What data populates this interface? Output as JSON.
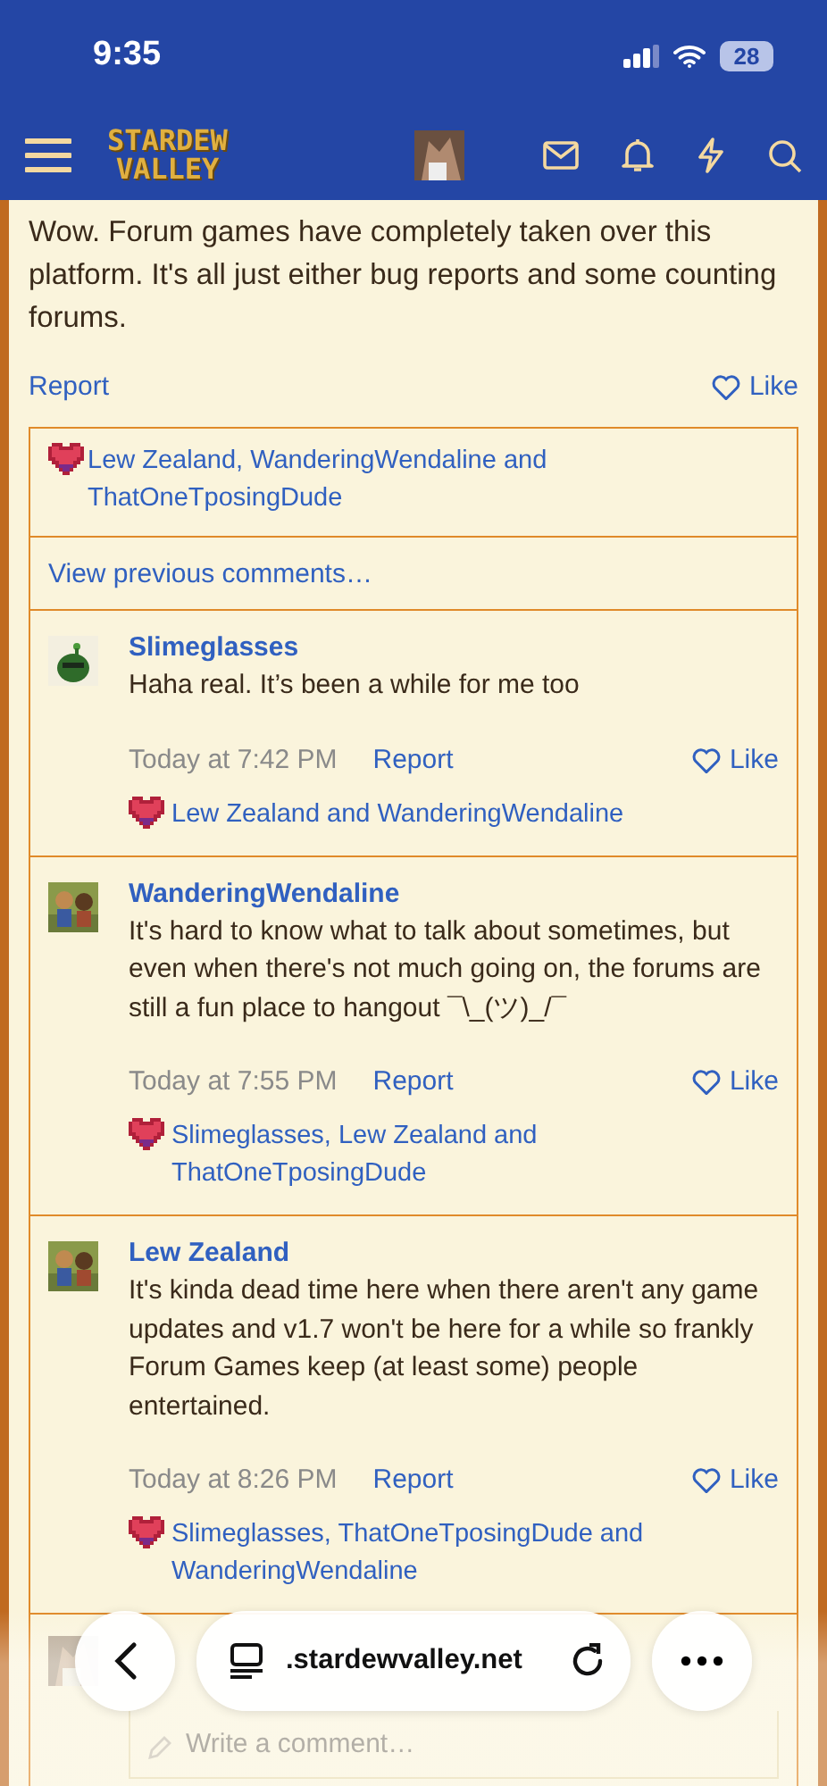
{
  "status_bar": {
    "time": "9:35",
    "battery": "28"
  },
  "nav": {
    "logo": [
      "STARDEW",
      "VALLEY"
    ]
  },
  "post": {
    "text": "Wow. Forum games have completely taken over this platform. It's all just either bug reports and some counting forums.",
    "report": "Report",
    "like": "Like"
  },
  "reactions": "Lew Zealand, WanderingWendaline and ThatOneTposingDude",
  "view_previous": "View previous comments…",
  "comments": [
    {
      "author": "Slimeglasses",
      "text": "Haha real. It’s been a while for me too",
      "time": "Today at 7:42 PM",
      "report": "Report",
      "like": "Like",
      "reactions": "Lew Zealand and WanderingWendaline"
    },
    {
      "author": "WanderingWendaline",
      "text": "It's hard to know what to talk about sometimes, but even when there's not much going on, the forums are still a fun place to hangout ¯\\_(ツ)_/¯",
      "time": "Today at 7:55 PM",
      "report": "Report",
      "like": "Like",
      "reactions": "Slimeglasses, Lew Zealand and ThatOneTposingDude"
    },
    {
      "author": "Lew Zealand",
      "text": "It's kinda dead time here when there aren't any game updates and v1.7 won't be here for a while so frankly Forum Games keep (at least some) people entertained.",
      "time": "Today at 8:26 PM",
      "report": "Report",
      "like": "Like",
      "reactions": "Slimeglasses, ThatOneTposingDude and WanderingWendaline"
    }
  ],
  "comment_field": {
    "placeholder": "Write a comment…"
  },
  "browser_bar": {
    "url": ".stardewvalley.net"
  }
}
